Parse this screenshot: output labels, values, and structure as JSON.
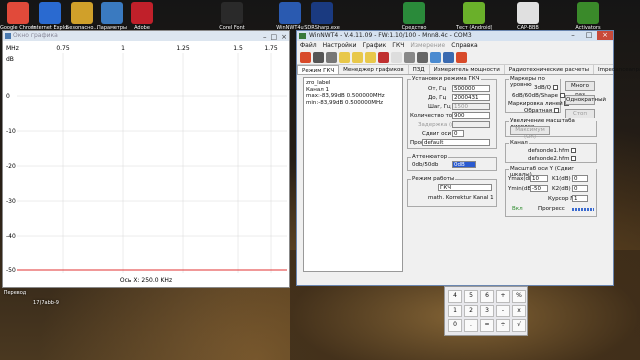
{
  "desktop_icons": [
    {
      "label": "Google Chrome",
      "color": "#e14a3a"
    },
    {
      "label": "Internet Explorer",
      "color": "#2a6ad0"
    },
    {
      "label": "Безопасно...",
      "color": "#d0a02a"
    },
    {
      "label": "Параметры",
      "color": "#3a7ac0"
    },
    {
      "label": "Adobe",
      "color": "#c0202a"
    },
    {
      "label": "Corel Font",
      "color": "#2a2a2a"
    },
    {
      "label": "WinNWT4u",
      "color": "#2a5ab0"
    },
    {
      "label": "SDRSharp.exe",
      "color": "#1a3a80"
    },
    {
      "label": "Средство",
      "color": "#2a8a3a"
    },
    {
      "label": "Тест (Android)",
      "color": "#6ab02a"
    },
    {
      "label": "CAP-BBB",
      "color": "#e0e0e0"
    },
    {
      "label": "Activators",
      "color": "#3a8a2a"
    }
  ],
  "left_labels": [
    "Перевод",
    "17)7abb-9"
  ],
  "graph_window": {
    "title": "Окно графика",
    "x_unit": "MHz",
    "x_ticks": [
      "0.75",
      "1",
      "1.25",
      "1.5",
      "1.75"
    ],
    "y_unit": "dB",
    "y_ticks": [
      "0",
      "-10",
      "-20",
      "-30",
      "-40",
      "-50"
    ],
    "footer": "Ось X: 250.0 KHz"
  },
  "main_window": {
    "title": "WinNWT4 - V.4.11.09 - FW:1.10/100 - Mnn8.4c - COM3",
    "menu": [
      "Файл",
      "Настройки",
      "График",
      "ГКЧ",
      "Измерение",
      "Справка"
    ],
    "menu_disabled_index": 4,
    "tabs": [
      "Режим ГКЧ",
      "Менеджер графиков",
      "ПЗД",
      "Измеритель мощности",
      "Радиотехнические расчеты",
      "Impedanceanpassung"
    ],
    "text_area": [
      "zro_label",
      "",
      "Канал 1",
      "max:-83,99dB 0.500000MHz",
      "min:-83,99dB 0.500000MHz"
    ],
    "sweep_group": {
      "title": "Установки режима ГКЧ",
      "start_label": "От, Гц",
      "start_value": "500000",
      "stop_label": "До, Гц",
      "stop_value": "2000431",
      "step_label": "Шаг, Гц",
      "step_value": "1500",
      "points_label": "Количество точек",
      "points_value": "900",
      "delay_label": "Задержка (мс)",
      "shift_label": "Сдвиг оси Y",
      "shift_value": "0",
      "profile_label": "Проф",
      "profile_value": "default"
    },
    "atten_group": {
      "title": "Аттенюатор",
      "label": "0db/50db",
      "value": "0dB"
    },
    "mode_group": {
      "title": "Режим работы",
      "value": "ГКЧ",
      "note": "math. Korrektur Kanal 1"
    },
    "markers_group": {
      "title": "Маркеры по уровню",
      "m1": "3dB/Q",
      "m2": "6dB/60dB/Shape",
      "m3": "Маркировка линей",
      "m4": "Обратная",
      "btn_multi": "Много раз",
      "btn_once": "Однократный",
      "btn_stop": "Стоп"
    },
    "zoom_group": {
      "title": "Увеличение масштаба дисплея",
      "value": "Максимум (On)"
    },
    "channel_group": {
      "title": "Канал",
      "f1": "defsonde1.hfm",
      "f2": "defsonde2.hfm"
    },
    "scale_group": {
      "title": "Масштаб оси Y (Сдвиг шкалы)",
      "ymax_label": "Ymax(dB)",
      "ymax_value": "10",
      "ymin_label": "Ymin(dB)",
      "ymin_value": "-50",
      "k1_label": "K1(dB)",
      "k1_value": "0",
      "k2_label": "K2(dB)",
      "k2_value": "0",
      "cursor_label": "Курсор №",
      "cursor_value": "1",
      "on_label": "Вкл",
      "progress_label": "Прогресс"
    }
  },
  "calculator": [
    "4",
    "5",
    "6",
    "+",
    "%",
    "1",
    "2",
    "3",
    "-",
    "x",
    "0",
    ".",
    "=",
    "÷",
    "√"
  ]
}
